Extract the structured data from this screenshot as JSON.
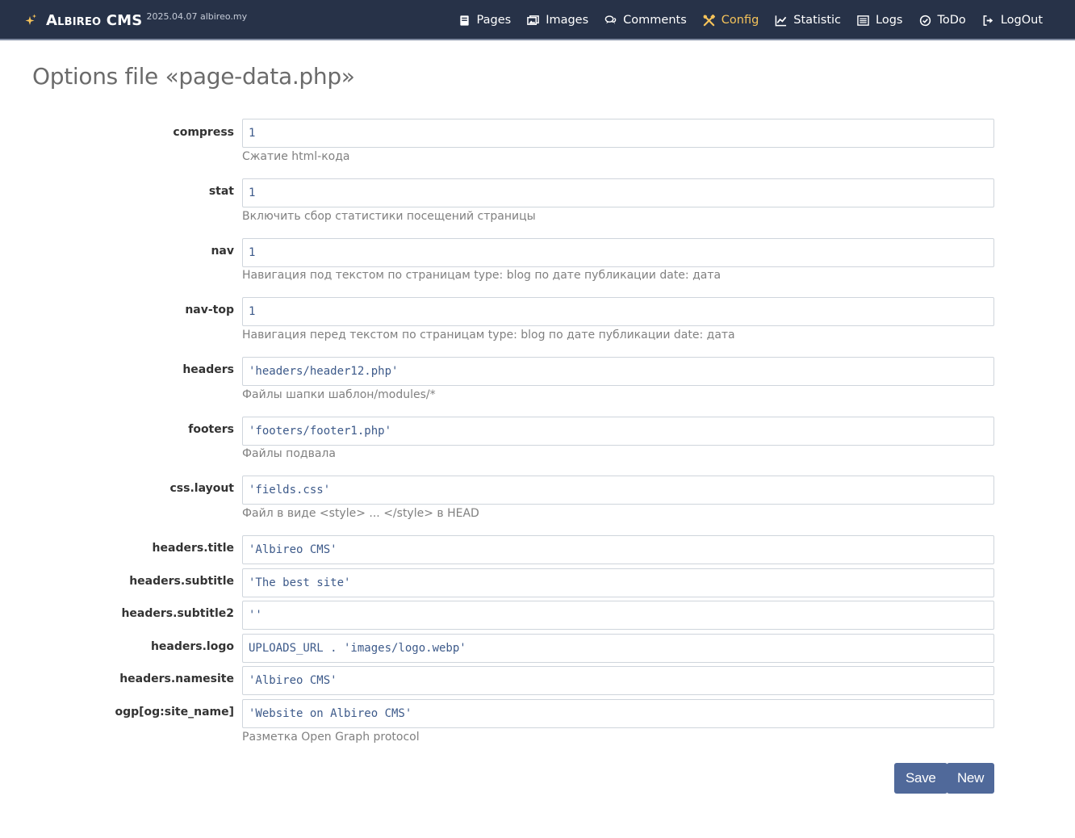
{
  "app": {
    "name": "Albireo CMS",
    "meta": "2025.04.07 albireo.my"
  },
  "nav": [
    {
      "label": "Pages",
      "icon": "book-icon",
      "active": false
    },
    {
      "label": "Images",
      "icon": "images-icon",
      "active": false
    },
    {
      "label": "Comments",
      "icon": "comments-icon",
      "active": false
    },
    {
      "label": "Config",
      "icon": "tools-icon",
      "active": true
    },
    {
      "label": "Statistic",
      "icon": "chart-icon",
      "active": false
    },
    {
      "label": "Logs",
      "icon": "list-icon",
      "active": false
    },
    {
      "label": "ToDo",
      "icon": "check-circle-icon",
      "active": false
    },
    {
      "label": "LogOut",
      "icon": "logout-icon",
      "active": false
    }
  ],
  "colors": {
    "topbar": "#273248",
    "active_nav": "#f5c35a",
    "button": "#50699a",
    "input_text": "#3d5a8a"
  },
  "page": {
    "title": "Options file «page-data.php»"
  },
  "fields": [
    {
      "label": "compress",
      "value": "1",
      "hint": "Сжатие html-кода"
    },
    {
      "label": "stat",
      "value": "1",
      "hint": "Включить сбор статистики посещений страницы"
    },
    {
      "label": "nav",
      "value": "1",
      "hint": "Навигация под текстом по страницам type: blog по дате публикации date: дата"
    },
    {
      "label": "nav-top",
      "value": "1",
      "hint": "Навигация перед текстом по страницам type: blog по дате публикации date: дата"
    },
    {
      "label": "headers",
      "value": "'headers/header12.php'",
      "hint": "Файлы шапки шаблон/modules/*"
    },
    {
      "label": "footers",
      "value": "'footers/footer1.php'",
      "hint": "Файлы подвала"
    },
    {
      "label": "css.layout",
      "value": "'fields.css'",
      "hint": "Файл в виде <style> ... </style> в HEAD"
    },
    {
      "label": "headers.title",
      "value": "'Albireo CMS'",
      "hint": ""
    },
    {
      "label": "headers.subtitle",
      "value": "'The best site'",
      "hint": ""
    },
    {
      "label": "headers.subtitle2",
      "value": "''",
      "hint": ""
    },
    {
      "label": "headers.logo",
      "value": "UPLOADS_URL . 'images/logo.webp'",
      "hint": ""
    },
    {
      "label": "headers.namesite",
      "value": "'Albireo CMS'",
      "hint": ""
    },
    {
      "label": "ogp[og:site_name]",
      "value": "'Website on Albireo CMS'",
      "hint": "Разметка Open Graph protocol"
    }
  ],
  "buttons": {
    "save": "Save",
    "new": "New"
  }
}
